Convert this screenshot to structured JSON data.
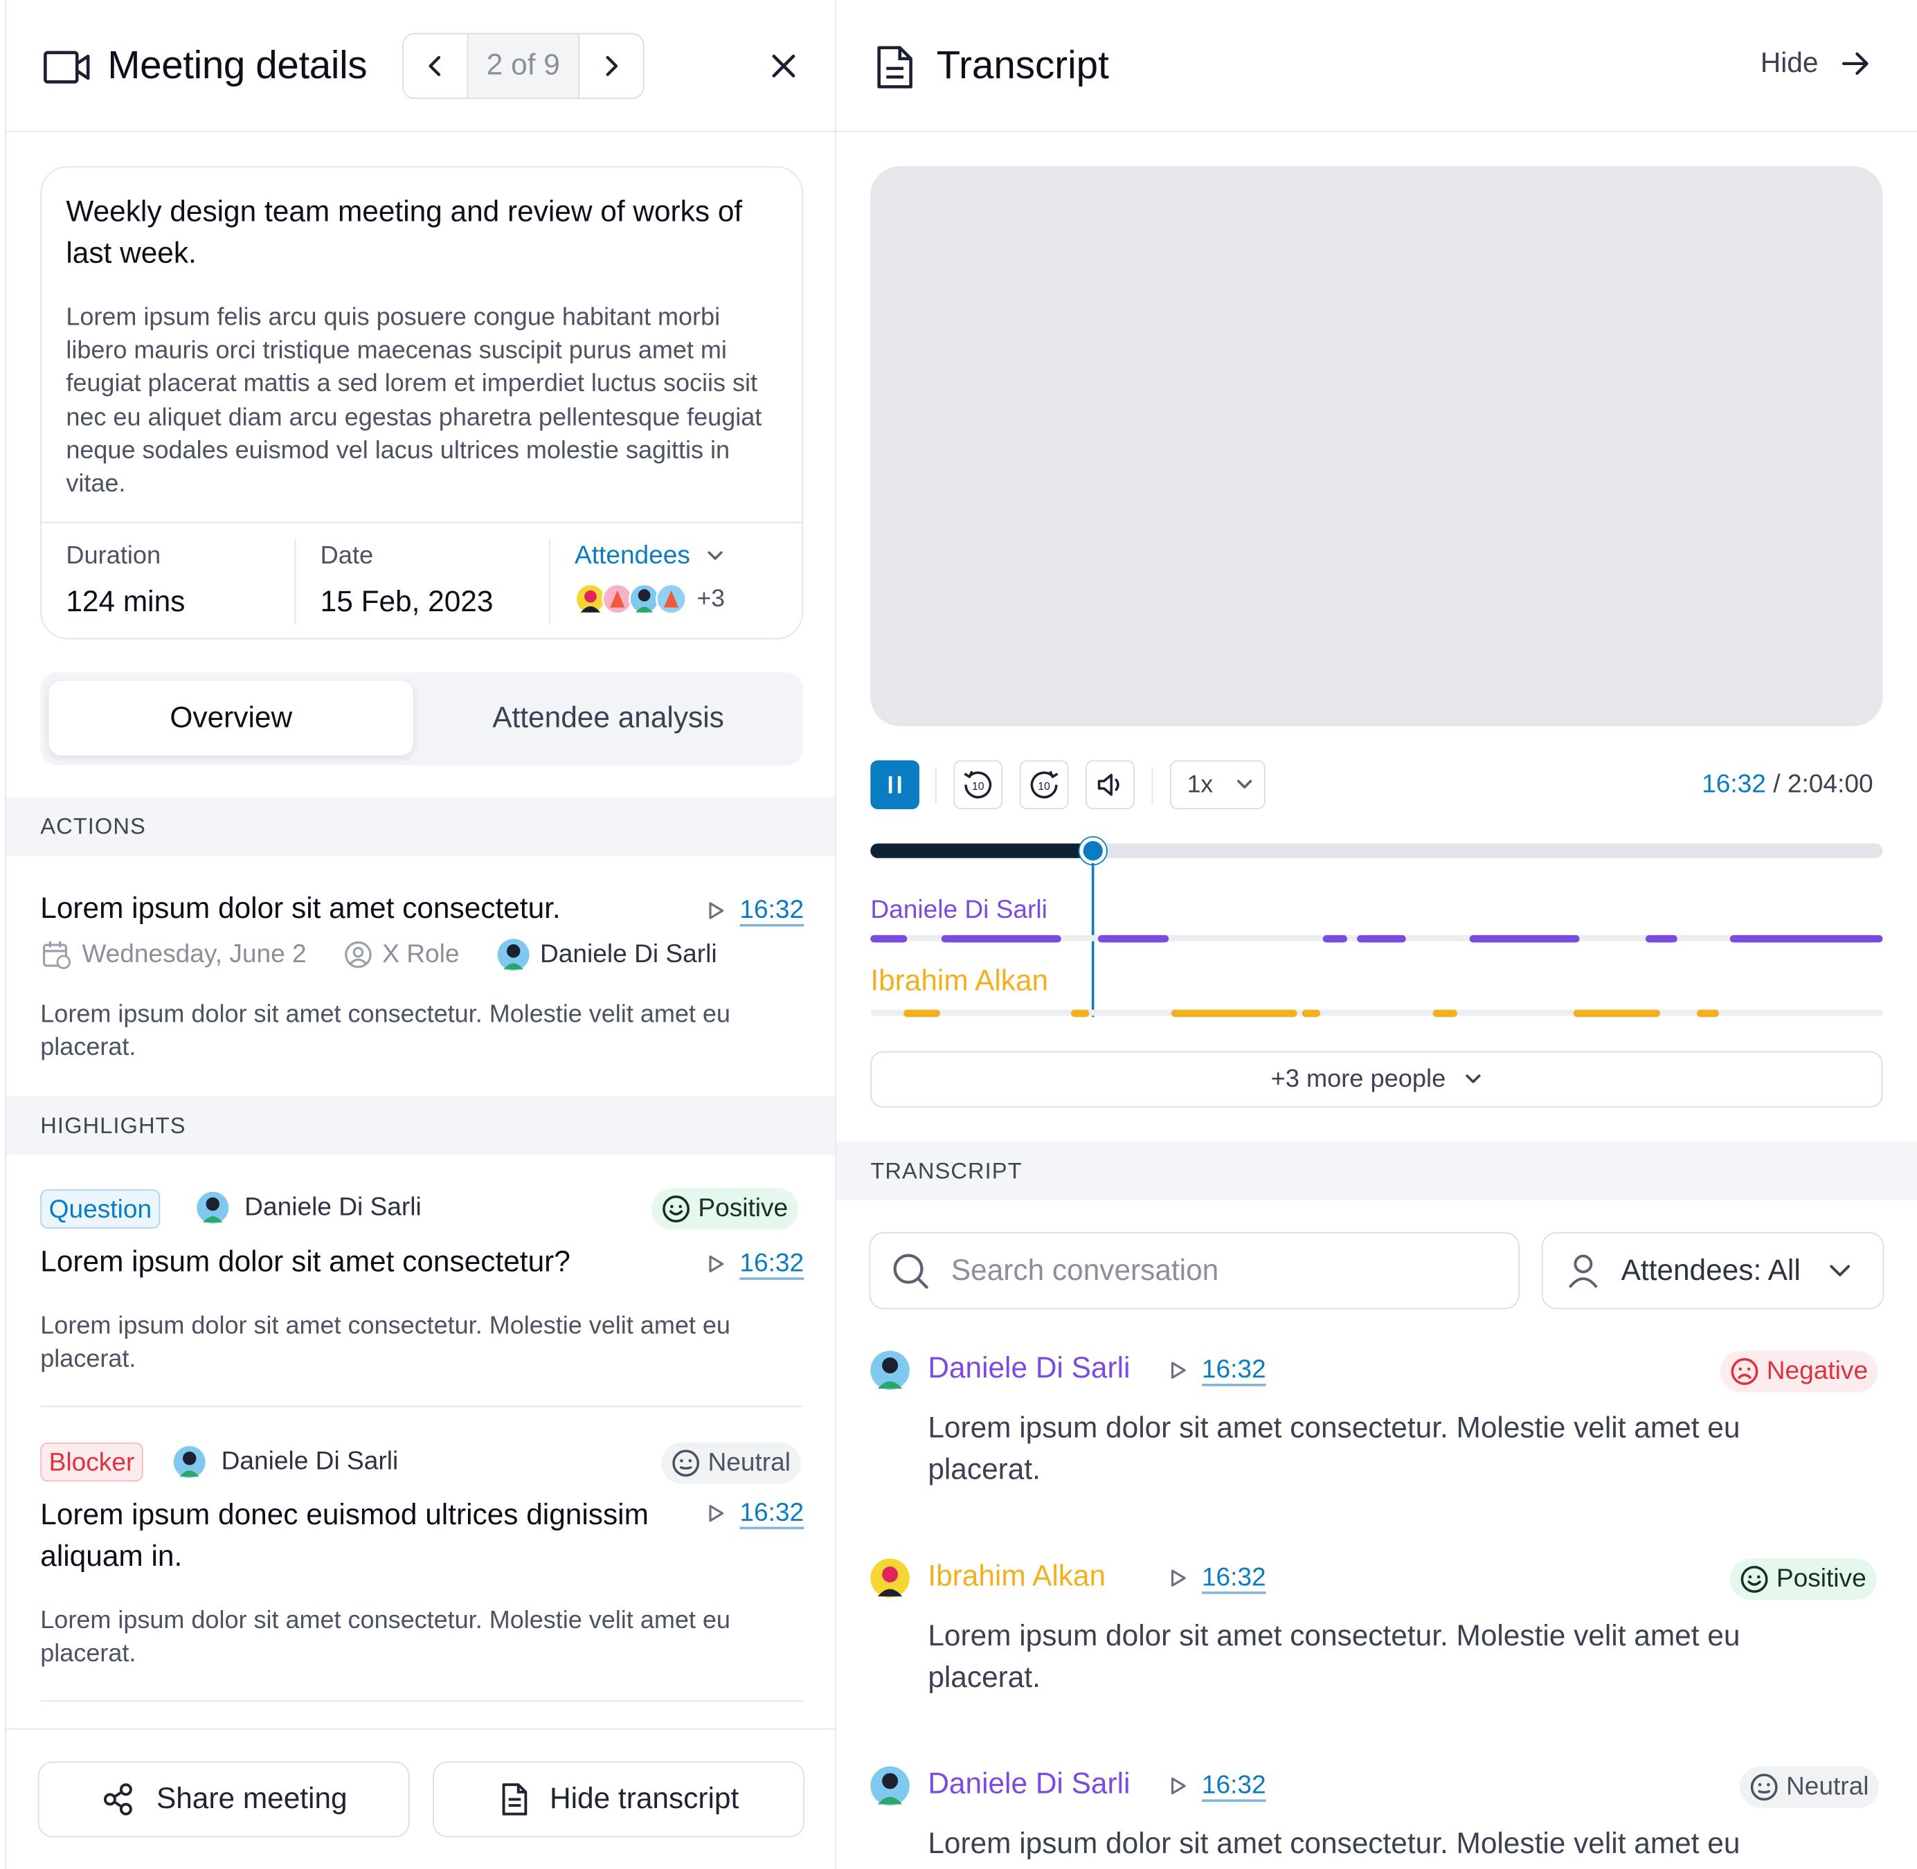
{
  "meeting": {
    "header_title": "Meeting details",
    "pager": "2 of 9",
    "card_title": "Weekly design team meeting and review of works of last week.",
    "card_desc": "Lorem ipsum felis arcu quis posuere congue habitant morbi libero mauris orci tristique maecenas suscipit purus amet mi feugiat placerat mattis a sed lorem et imperdiet luctus sociis sit nec eu aliquet diam arcu egestas pharetra pellentesque feugiat neque sodales euismod vel lacus ultrices molestie sagittis in vitae.",
    "duration_label": "Duration",
    "duration_value": "124 mins",
    "date_label": "Date",
    "date_value": "15 Feb, 2023",
    "attendees_label": "Attendees",
    "attendees_more": "+3"
  },
  "tabs": {
    "overview": "Overview",
    "attendee_analysis": "Attendee analysis"
  },
  "actions": {
    "section": "ACTIONS",
    "title": "Lorem ipsum dolor sit amet consectetur.",
    "time": "16:32",
    "date": "Wednesday, June 2",
    "role": "X Role",
    "person": "Daniele Di Sarli",
    "body": "Lorem ipsum dolor sit amet consectetur. Molestie velit amet eu placerat."
  },
  "highlights": {
    "section": "HIGHLIGHTS",
    "items": [
      {
        "tag": "Question",
        "person": "Daniele Di Sarli",
        "sentiment": "Positive",
        "title": "Lorem ipsum dolor sit amet consectetur?",
        "time": "16:32",
        "body": "Lorem ipsum dolor sit amet consectetur. Molestie velit amet eu placerat."
      },
      {
        "tag": "Blocker",
        "person": "Daniele Di Sarli",
        "sentiment": "Neutral",
        "title": "Lorem ipsum donec euismod ultrices dignissim aliquam in.",
        "time": "16:32",
        "body": "Lorem ipsum dolor sit amet consectetur. Molestie velit amet eu placerat."
      }
    ]
  },
  "footer": {
    "share": "Share meeting",
    "hide_transcript": "Hide transcript"
  },
  "transcript_panel": {
    "title": "Transcript",
    "hide": "Hide",
    "speed": "1x",
    "current_time": "16:32",
    "total_time": " / 2:04:00",
    "progress": 0.22,
    "speakers": [
      {
        "name": "Daniele Di Sarli",
        "color": "#7b4ae2"
      },
      {
        "name": "Ibrahim Alkan",
        "color": "#f2b01e"
      }
    ],
    "more_people": "+3 more people",
    "section": "TRANSCRIPT",
    "search_placeholder": "Search conversation",
    "attendee_filter": "Attendees: All",
    "entries": [
      {
        "name": "Daniele Di Sarli",
        "time": "16:32",
        "sentiment": "Negative",
        "text": "Lorem ipsum dolor sit amet consectetur. Molestie velit amet eu placerat."
      },
      {
        "name": "Ibrahim Alkan",
        "time": "16:32",
        "sentiment": "Positive",
        "text": "Lorem ipsum dolor sit amet consectetur. Molestie velit amet eu placerat."
      },
      {
        "name": "Daniele Di Sarli",
        "time": "16:32",
        "sentiment": "Neutral",
        "text": "Lorem ipsum dolor sit amet consectetur. Molestie velit amet eu placerat."
      }
    ]
  },
  "colors": {
    "accent": "#0a7cc1",
    "purple": "#7b4ae2",
    "yellow": "#f2b01e",
    "negative": "#e0323e",
    "positive": "#17a34a"
  }
}
